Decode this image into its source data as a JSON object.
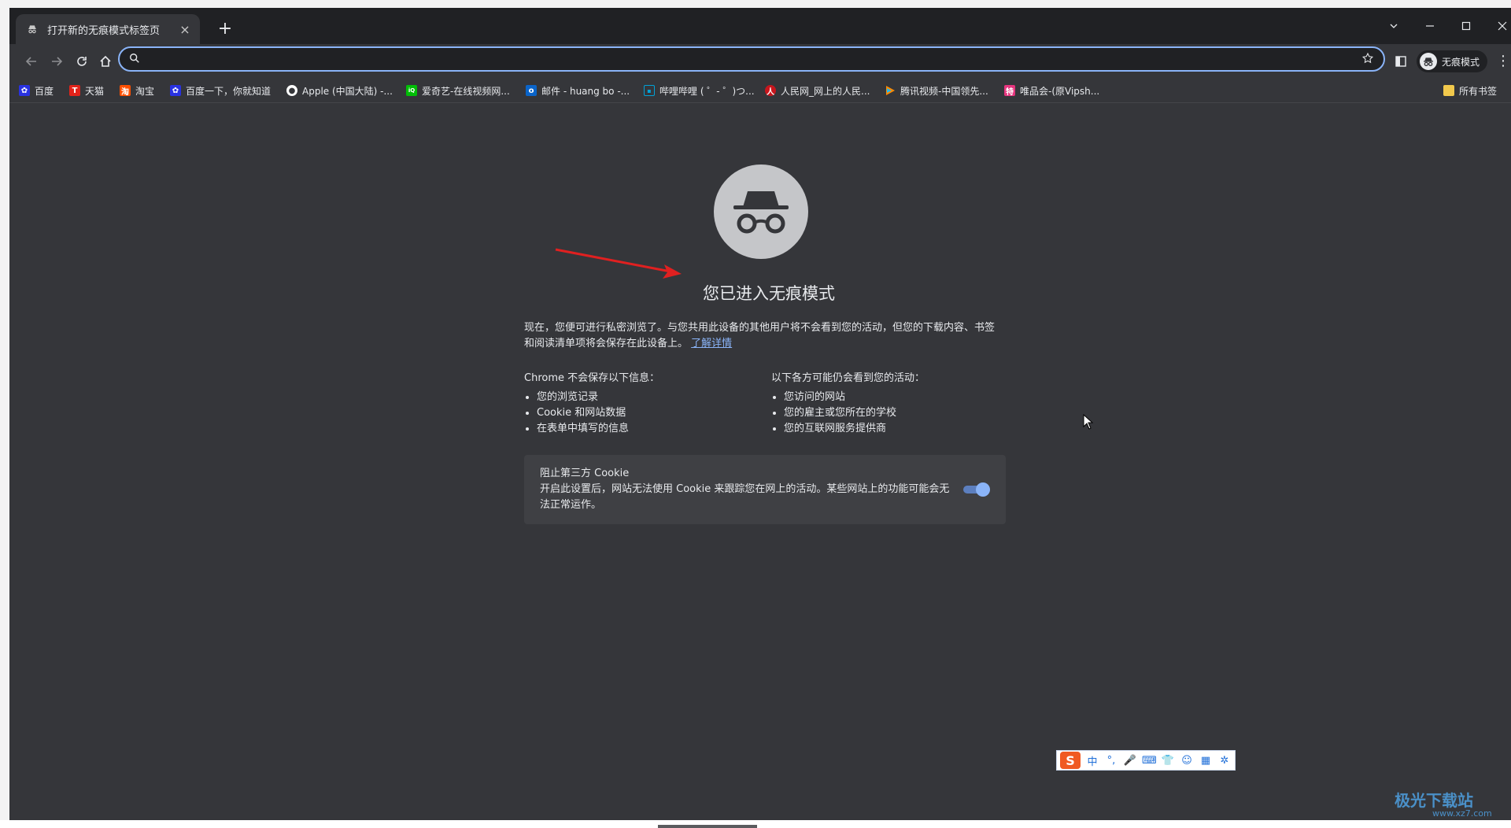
{
  "window": {
    "tab_title": "打开新的无痕模式标签页",
    "tab_close": "×",
    "new_tab": "+"
  },
  "toolbar": {
    "omnibox_value": "",
    "profile_label": "无痕模式",
    "menu": "⋮"
  },
  "bookmarks": [
    {
      "label": "百度",
      "icon": "baidu-paw-icon",
      "color": "#2932e1"
    },
    {
      "label": "天猫",
      "icon": "tmall-icon",
      "color": "#e2231a"
    },
    {
      "label": "淘宝",
      "icon": "taobao-icon",
      "color": "#ff5000"
    },
    {
      "label": "百度一下，你就知道",
      "icon": "baidu-paw-icon",
      "color": "#2932e1"
    },
    {
      "label": "Apple (中国大陆) -...",
      "icon": "apple-icon",
      "color": "#ffffff"
    },
    {
      "label": "爱奇艺-在线视频网...",
      "icon": "iqiyi-icon",
      "color": "#00be06"
    },
    {
      "label": "邮件 - huang bo -...",
      "icon": "outlook-icon",
      "color": "#0a64c9"
    },
    {
      "label": "哔哩哔哩 ( ゜- ゜)つ...",
      "icon": "bilibili-icon",
      "color": "#00a1d6"
    },
    {
      "label": "人民网_网上的人民...",
      "icon": "people-icon",
      "color": "#c8161d"
    },
    {
      "label": "腾讯视频-中国领先...",
      "icon": "tencent-video-icon",
      "color": "#ff8a00"
    },
    {
      "label": "唯品会-(原Vipsh...",
      "icon": "vip-icon",
      "color": "#e6357e"
    }
  ],
  "all_bookmarks": "所有书签",
  "page": {
    "heading": "您已进入无痕模式",
    "intro": "现在，您便可进行私密浏览了。与您共用此设备的其他用户将不会看到您的活动，但您的下载内容、书签和阅读清单项将会保存在此设备上。",
    "learn_more": "了解详情",
    "not_saved_heading": "Chrome 不会保存以下信息：",
    "not_saved": [
      "您的浏览记录",
      "Cookie 和网站数据",
      "在表单中填写的信息"
    ],
    "visible_heading": "以下各方可能仍会看到您的活动：",
    "visible": [
      "您访问的网站",
      "您的雇主或您所在的学校",
      "您的互联网服务提供商"
    ],
    "cookie_title": "阻止第三方 Cookie",
    "cookie_desc": "开启此设置后，网站无法使用 Cookie 来跟踪您在网上的活动。某些网站上的功能可能会无法正常运作。",
    "cookie_toggle_on": true
  },
  "ime": {
    "logo": "S",
    "items": [
      "中",
      "°,",
      "🎤",
      "⌨",
      "👕",
      "☺",
      "▦",
      "✲"
    ]
  },
  "watermark": {
    "title": "极光下载站",
    "url": "www.xz7.com"
  },
  "colors": {
    "accent": "#8ab4f8",
    "background": "#35363a",
    "annotation_arrow": "#e02020"
  }
}
